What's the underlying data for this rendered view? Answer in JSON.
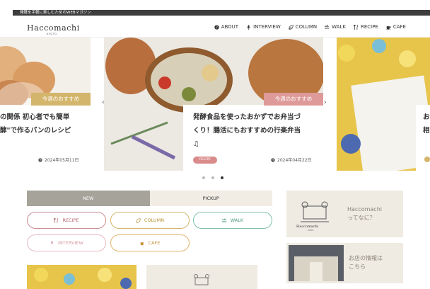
{
  "header": {
    "tagline": "発酵を手軽に楽しむためのWEBマガジン",
    "logo": "Haccomachi",
    "logo_sub": "KYOTO",
    "nav": [
      {
        "label": "ABOUT",
        "icon": "question-circle-icon"
      },
      {
        "label": "INTERVIEW",
        "icon": "microphone-icon"
      },
      {
        "label": "COLUMN",
        "icon": "leaf-icon"
      },
      {
        "label": "WALK",
        "icon": "walk-arrow-icon"
      },
      {
        "label": "RECIPE",
        "icon": "utensils-icon"
      },
      {
        "label": "CAFE",
        "icon": "coffee-cup-icon"
      }
    ]
  },
  "carousel": {
    "slides": [
      {
        "headline": "の関係 初心者でも簡単\n酵\"で作るパンのレシピ",
        "badge": "今週のおすすめ",
        "date": "2024年05月11日"
      },
      {
        "headline": "発酵食品を使ったおかずでお弁当づ\nくり！腸活にもおすすめの行楽弁当\n♫",
        "badge": "今週のおすすめ",
        "tag": "RECIPE",
        "date": "2024年04月22日"
      },
      {
        "headline": "お\n相",
        "badge": ""
      }
    ],
    "prev_arrow": "‹",
    "next_arrow": "›",
    "dots": 3,
    "active_dot": 2
  },
  "tabs": [
    {
      "label": "NEW",
      "active": true
    },
    {
      "label": "PICKUP",
      "active": false
    }
  ],
  "categories": [
    {
      "label": "RECIPE",
      "icon": "utensils-icon",
      "color": "#c98c94"
    },
    {
      "label": "COLUMN",
      "icon": "leaf-icon",
      "color": "#d3b56b"
    },
    {
      "label": "WALK",
      "icon": "walk-arrow-icon",
      "color": "#7fbfa8"
    },
    {
      "label": "INTERVIEW",
      "icon": "microphone-icon",
      "color": "#e8b8c0"
    },
    {
      "label": "CAFE",
      "icon": "coffee-cup-icon",
      "color": "#e0b46a"
    }
  ],
  "sidebar": {
    "about_card": {
      "text": "Haccomachi\nってなに？",
      "logo": "Haccomachi",
      "logo_sub": "KYOTO"
    },
    "shop_card": {
      "text": "お店の情報は\nこちら"
    }
  },
  "colors": {
    "accent_gold": "#d3b56b",
    "accent_pink": "#d98b8b",
    "beige": "#efebe2",
    "tab_active": "#a6a39a"
  }
}
